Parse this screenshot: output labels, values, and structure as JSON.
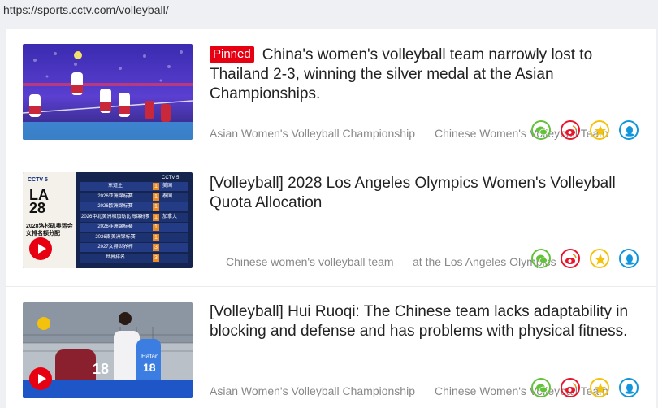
{
  "browser": {
    "url": "https://sports.cctv.com/volleyball/"
  },
  "items": [
    {
      "badge": "Pinned",
      "title": "China's women's volleyball team narrowly lost to Thailand 2-3, winning the silver medal at the Asian Championships.",
      "tags": [
        "Asian Women's Volleyball Championship",
        "Chinese Women's Volleyball Team"
      ],
      "thumb_icon": "volleyball-court-photo"
    },
    {
      "title": "[Volleyball] 2028 Los Angeles Olympics Women's Volleyball Quota Allocation",
      "tags": [
        "Chinese women's volleyball team",
        "at the Los Angeles Olympics"
      ],
      "thumb": {
        "channel": "CCTV 5",
        "logo_text": "LA 28",
        "caption": "2028洛杉矶奥运会 女排名额分配",
        "rows": [
          {
            "label": "东道主",
            "count": "1",
            "country": "美国"
          },
          {
            "label": "2026亚洲锦标赛",
            "count": "1",
            "country": "泰国"
          },
          {
            "label": "2026欧洲锦标赛",
            "count": "1",
            "country": ""
          },
          {
            "label": "2026中北美洲和加勒比海锦标赛",
            "count": "1",
            "country": "加拿大"
          },
          {
            "label": "2026非洲锦标赛",
            "count": "1",
            "country": ""
          },
          {
            "label": "2026南美洲锦标赛",
            "count": "1",
            "country": ""
          },
          {
            "label": "2027女排世界杯",
            "count": "3",
            "country": ""
          },
          {
            "label": "世界排名",
            "count": "3",
            "country": ""
          }
        ]
      }
    },
    {
      "title": "[Volleyball] Hui Ruoqi: The Chinese team lacks adaptability in blocking and defense and has problems with physical fitness.",
      "tags": [
        "Asian Women's Volleyball Championship",
        "Chinese Women's Volleyball Team"
      ],
      "thumb": {
        "jersey_left": "18",
        "jersey_right": "18",
        "sponsor": "Hafan"
      }
    }
  ],
  "share": [
    "wechat-icon",
    "weibo-icon",
    "qzone-icon",
    "qq-icon"
  ],
  "colors": {
    "pinned": "#e60012",
    "wechat": "#63c23a",
    "weibo": "#e6162d",
    "qzone": "#f4c20d",
    "qq": "#1296db"
  }
}
